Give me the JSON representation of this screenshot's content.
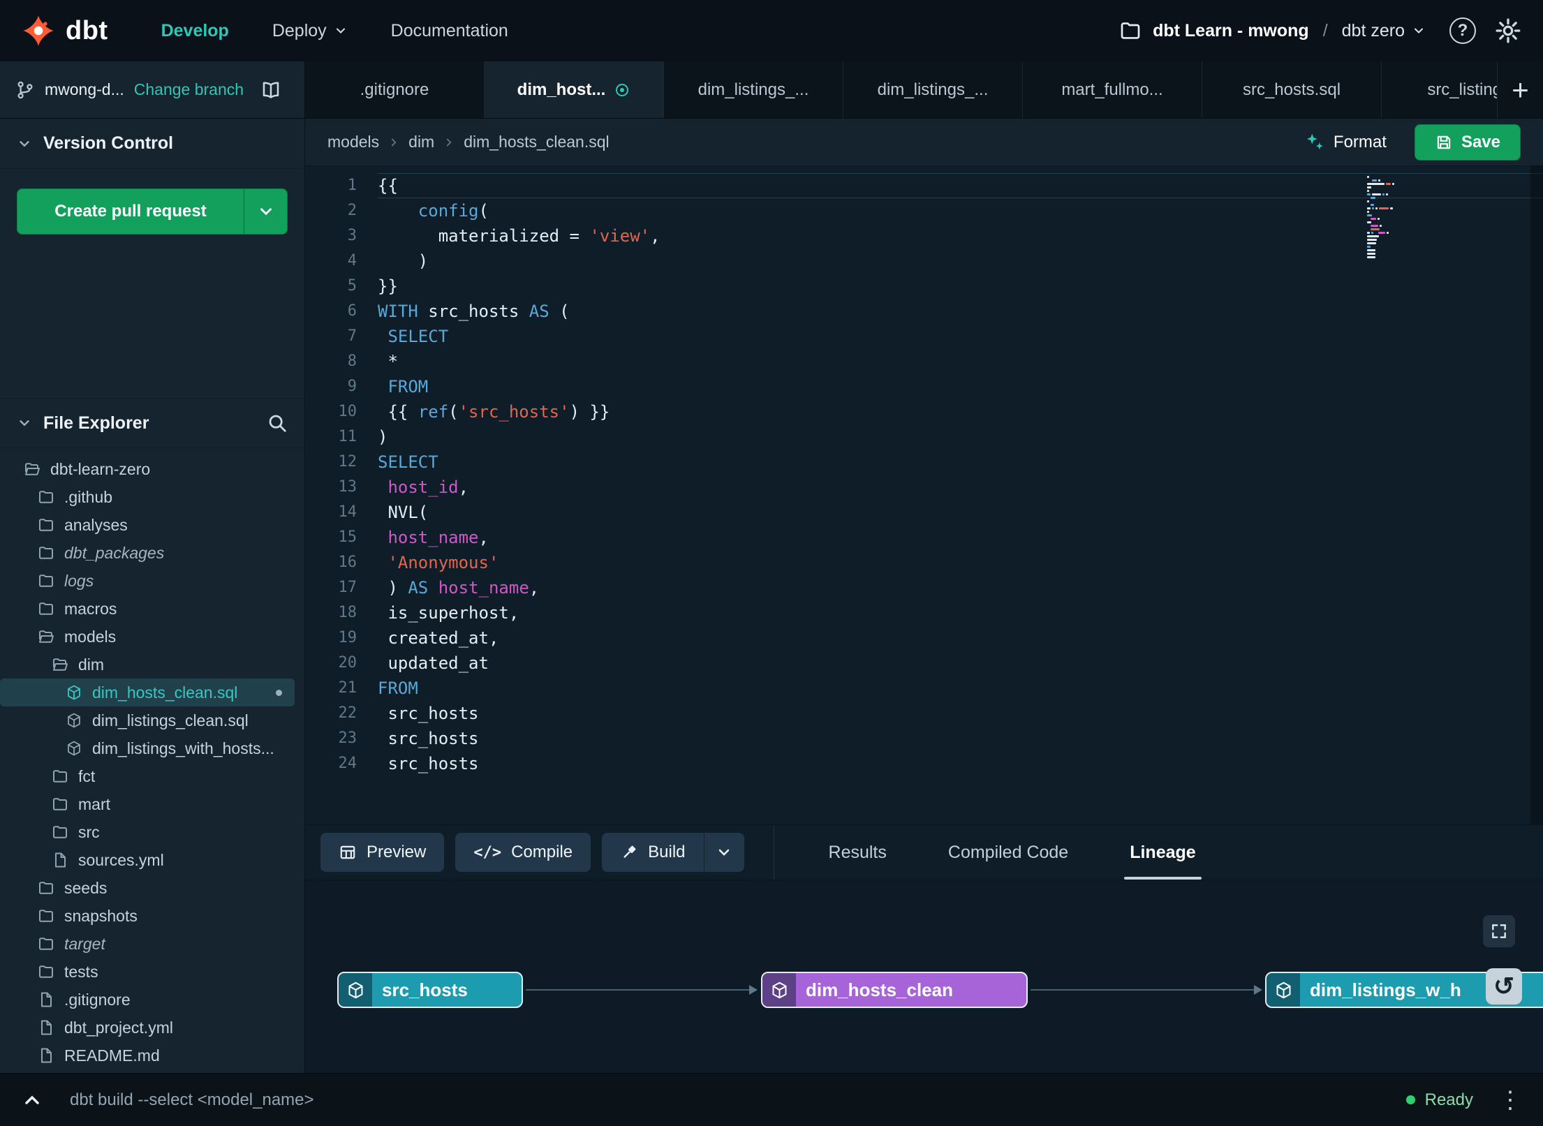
{
  "topnav": {
    "logo": "dbt",
    "nav": [
      {
        "label": "Develop",
        "active": true,
        "chevron": false
      },
      {
        "label": "Deploy",
        "active": false,
        "chevron": true
      },
      {
        "label": "Documentation",
        "active": false,
        "chevron": false
      }
    ],
    "project": "dbt Learn - mwong",
    "sep": "/",
    "environment": "dbt zero"
  },
  "branch_bar": {
    "branch_name": "mwong-d...",
    "change_branch_label": "Change branch"
  },
  "editor_tabs": [
    {
      "label": ".gitignore",
      "active": false,
      "modified": false
    },
    {
      "label": "dim_host...",
      "active": true,
      "modified": true
    },
    {
      "label": "dim_listings_...",
      "active": false,
      "modified": false
    },
    {
      "label": "dim_listings_...",
      "active": false,
      "modified": false
    },
    {
      "label": "mart_fullmo...",
      "active": false,
      "modified": false
    },
    {
      "label": "src_hosts.sql",
      "active": false,
      "modified": false
    },
    {
      "label": "src_listings.",
      "active": false,
      "modified": false
    }
  ],
  "tab_add_label": "+",
  "version_control": {
    "title": "Version Control",
    "create_pr_label": "Create pull request"
  },
  "file_explorer": {
    "title": "File Explorer",
    "tree": [
      {
        "label": "dbt-learn-zero",
        "icon": "folder-open",
        "depth": 0,
        "italic": false,
        "selected": false,
        "modified": false
      },
      {
        "label": ".github",
        "icon": "folder",
        "depth": 1,
        "italic": false,
        "selected": false,
        "modified": false
      },
      {
        "label": "analyses",
        "icon": "folder",
        "depth": 1,
        "italic": false,
        "selected": false,
        "modified": false
      },
      {
        "label": "dbt_packages",
        "icon": "folder",
        "depth": 1,
        "italic": true,
        "selected": false,
        "modified": false
      },
      {
        "label": "logs",
        "icon": "folder",
        "depth": 1,
        "italic": true,
        "selected": false,
        "modified": false
      },
      {
        "label": "macros",
        "icon": "folder",
        "depth": 1,
        "italic": false,
        "selected": false,
        "modified": false
      },
      {
        "label": "models",
        "icon": "folder-open",
        "depth": 1,
        "italic": false,
        "selected": false,
        "modified": false
      },
      {
        "label": "dim",
        "icon": "folder-open",
        "depth": 2,
        "italic": false,
        "selected": false,
        "modified": false
      },
      {
        "label": "dim_hosts_clean.sql",
        "icon": "model",
        "depth": 3,
        "italic": false,
        "selected": true,
        "modified": true
      },
      {
        "label": "dim_listings_clean.sql",
        "icon": "model",
        "depth": 3,
        "italic": false,
        "selected": false,
        "modified": false
      },
      {
        "label": "dim_listings_with_hosts...",
        "icon": "model",
        "depth": 3,
        "italic": false,
        "selected": false,
        "modified": false
      },
      {
        "label": "fct",
        "icon": "folder",
        "depth": 2,
        "italic": false,
        "selected": false,
        "modified": false
      },
      {
        "label": "mart",
        "icon": "folder",
        "depth": 2,
        "italic": false,
        "selected": false,
        "modified": false
      },
      {
        "label": "src",
        "icon": "folder",
        "depth": 2,
        "italic": false,
        "selected": false,
        "modified": false
      },
      {
        "label": "sources.yml",
        "icon": "file",
        "depth": 2,
        "italic": false,
        "selected": false,
        "modified": false
      },
      {
        "label": "seeds",
        "icon": "folder",
        "depth": 1,
        "italic": false,
        "selected": false,
        "modified": false
      },
      {
        "label": "snapshots",
        "icon": "folder",
        "depth": 1,
        "italic": false,
        "selected": false,
        "modified": false
      },
      {
        "label": "target",
        "icon": "folder",
        "depth": 1,
        "italic": true,
        "selected": false,
        "modified": false
      },
      {
        "label": "tests",
        "icon": "folder",
        "depth": 1,
        "italic": false,
        "selected": false,
        "modified": false
      },
      {
        "label": ".gitignore",
        "icon": "file",
        "depth": 1,
        "italic": false,
        "selected": false,
        "modified": false
      },
      {
        "label": "dbt_project.yml",
        "icon": "file",
        "depth": 1,
        "italic": false,
        "selected": false,
        "modified": false
      },
      {
        "label": "README.md",
        "icon": "file",
        "depth": 1,
        "italic": false,
        "selected": false,
        "modified": false
      }
    ]
  },
  "editor": {
    "breadcrumb": [
      "models",
      "dim",
      "dim_hosts_clean.sql"
    ],
    "format_label": "Format",
    "save_label": "Save",
    "code": [
      [
        [
          "p",
          "{{"
        ]
      ],
      [
        [
          "p",
          "    "
        ],
        [
          "k",
          "config"
        ],
        [
          "p",
          "("
        ]
      ],
      [
        [
          "p",
          "      materialized = "
        ],
        [
          "s",
          "'view'"
        ],
        [
          "p",
          ","
        ]
      ],
      [
        [
          "p",
          "    )"
        ]
      ],
      [
        [
          "p",
          "}}"
        ]
      ],
      [
        [
          "k",
          "WITH"
        ],
        [
          "p",
          " src_hosts "
        ],
        [
          "k",
          "AS"
        ],
        [
          "p",
          " ("
        ]
      ],
      [
        [
          "p",
          " "
        ],
        [
          "k",
          "SELECT"
        ]
      ],
      [
        [
          "p",
          " *"
        ]
      ],
      [
        [
          "p",
          " "
        ],
        [
          "k",
          "FROM"
        ]
      ],
      [
        [
          "p",
          " {{ "
        ],
        [
          "k",
          "ref"
        ],
        [
          "p",
          "("
        ],
        [
          "s",
          "'src_hosts'"
        ],
        [
          "p",
          ") }}"
        ]
      ],
      [
        [
          "p",
          ")"
        ]
      ],
      [
        [
          "k",
          "SELECT"
        ]
      ],
      [
        [
          "p",
          " "
        ],
        [
          "i",
          "host_id"
        ],
        [
          "p",
          ","
        ]
      ],
      [
        [
          "p",
          " NVL("
        ]
      ],
      [
        [
          "p",
          " "
        ],
        [
          "i",
          "host_name"
        ],
        [
          "p",
          ","
        ]
      ],
      [
        [
          "p",
          " "
        ],
        [
          "s",
          "'Anonymous'"
        ]
      ],
      [
        [
          "p",
          " ) "
        ],
        [
          "k",
          "AS"
        ],
        [
          "p",
          " "
        ],
        [
          "i",
          "host_name"
        ],
        [
          "p",
          ","
        ]
      ],
      [
        [
          "p",
          " is_superhost,"
        ]
      ],
      [
        [
          "p",
          " created_at,"
        ]
      ],
      [
        [
          "p",
          " updated_at"
        ]
      ],
      [
        [
          "k",
          "FROM"
        ]
      ],
      [
        [
          "p",
          " src_hosts"
        ]
      ],
      [
        [
          "p",
          " src_hosts"
        ]
      ],
      [
        [
          "p",
          " src_hosts"
        ]
      ]
    ]
  },
  "bottom_panel": {
    "preview_label": "Preview",
    "compile_label": "Compile",
    "build_label": "Build",
    "tabs": [
      {
        "label": "Results",
        "active": false
      },
      {
        "label": "Compiled Code",
        "active": false
      },
      {
        "label": "Lineage",
        "active": true
      }
    ],
    "lineage_nodes": [
      {
        "label": "src_hosts",
        "color": "#1d9cb0"
      },
      {
        "label": "dim_hosts_clean",
        "color": "#a763d8"
      },
      {
        "label": "dim_listings_w_h",
        "color": "#1d9cb0"
      }
    ]
  },
  "command_bar": {
    "command": "dbt build --select <model_name>",
    "status": "Ready"
  },
  "colors": {
    "accent_teal": "#2fc7b5",
    "action_green": "#12a05c",
    "logo_orange": "#ff5c35",
    "code_keyword": "#58a9da",
    "code_string": "#e2664f",
    "code_identifier": "#ce58c6"
  }
}
